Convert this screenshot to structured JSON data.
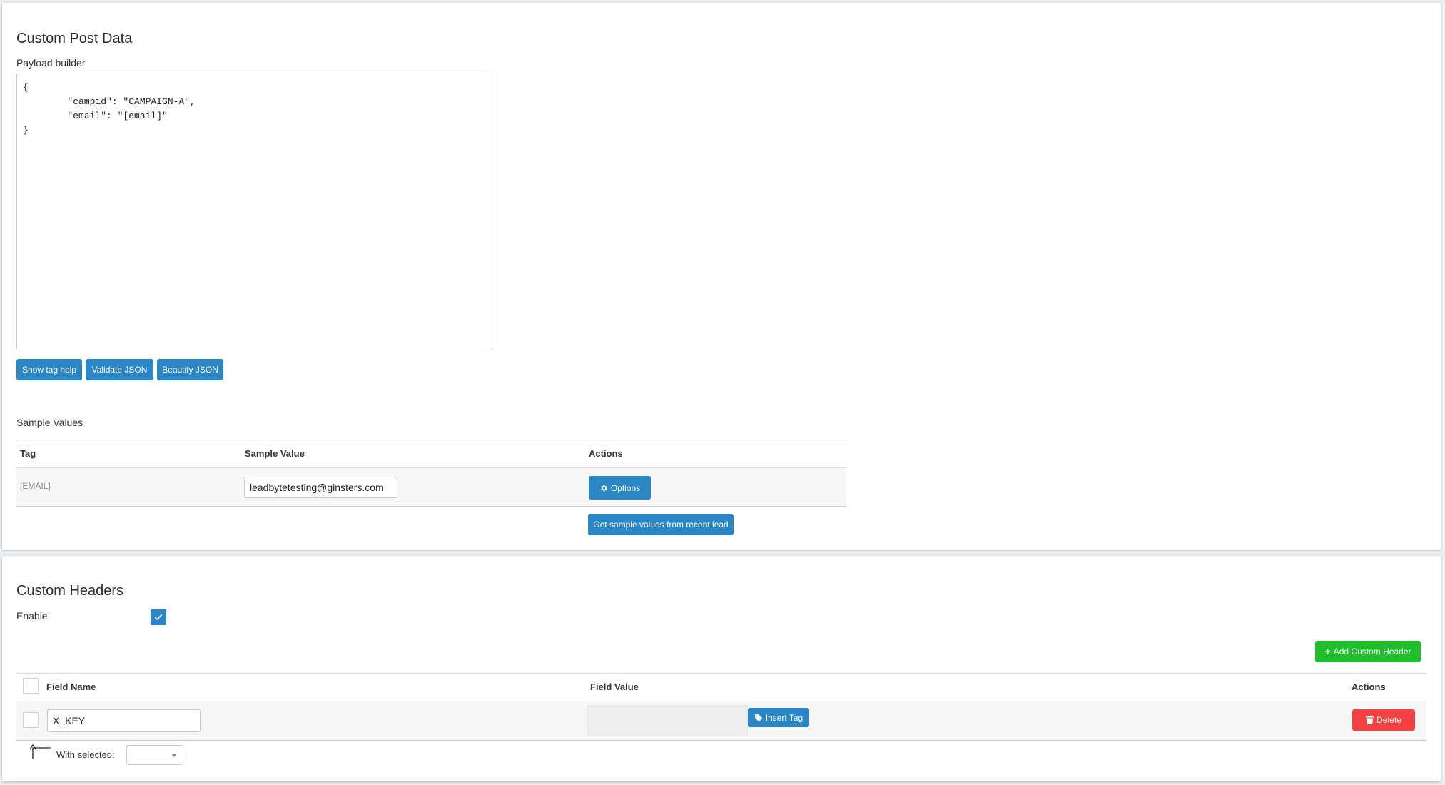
{
  "post_data": {
    "title": "Custom Post Data",
    "payload_label": "Payload builder",
    "payload_text": "{\n        \"campid\": \"CAMPAIGN-A\",\n        \"email\": \"[email]\"\n}",
    "buttons": {
      "show_tag_help": "Show tag help",
      "validate_json": "Validate JSON",
      "beautify_json": "Beautify JSON"
    },
    "sample_values": {
      "label": "Sample Values",
      "columns": [
        "Tag",
        "Sample Value",
        "Actions"
      ],
      "rows": [
        {
          "tag": "[EMAIL]",
          "value": "leadbytetesting@ginsters.com",
          "action": "Options"
        }
      ],
      "get_sample_button": "Get sample values from recent lead"
    }
  },
  "custom_headers": {
    "title": "Custom Headers",
    "enable_label": "Enable",
    "enable_checked": true,
    "add_button": "Add Custom Header",
    "columns": [
      "Field Name",
      "Field Value",
      "Actions"
    ],
    "rows": [
      {
        "field_name": "X_KEY",
        "field_value": "",
        "insert_tag": "Insert Tag",
        "delete": "Delete"
      }
    ],
    "with_selected_label": "With selected:",
    "with_selected_value": ""
  },
  "colors": {
    "primary": "#2a86c5",
    "success": "#1fbf2b",
    "danger": "#f44040"
  },
  "icons": {
    "options": "gear-icon",
    "insert_tag": "tag-icon",
    "delete": "trash-icon",
    "add": "plus-icon",
    "with_selected": "corner-up-arrow-icon",
    "enable": "check-icon"
  }
}
